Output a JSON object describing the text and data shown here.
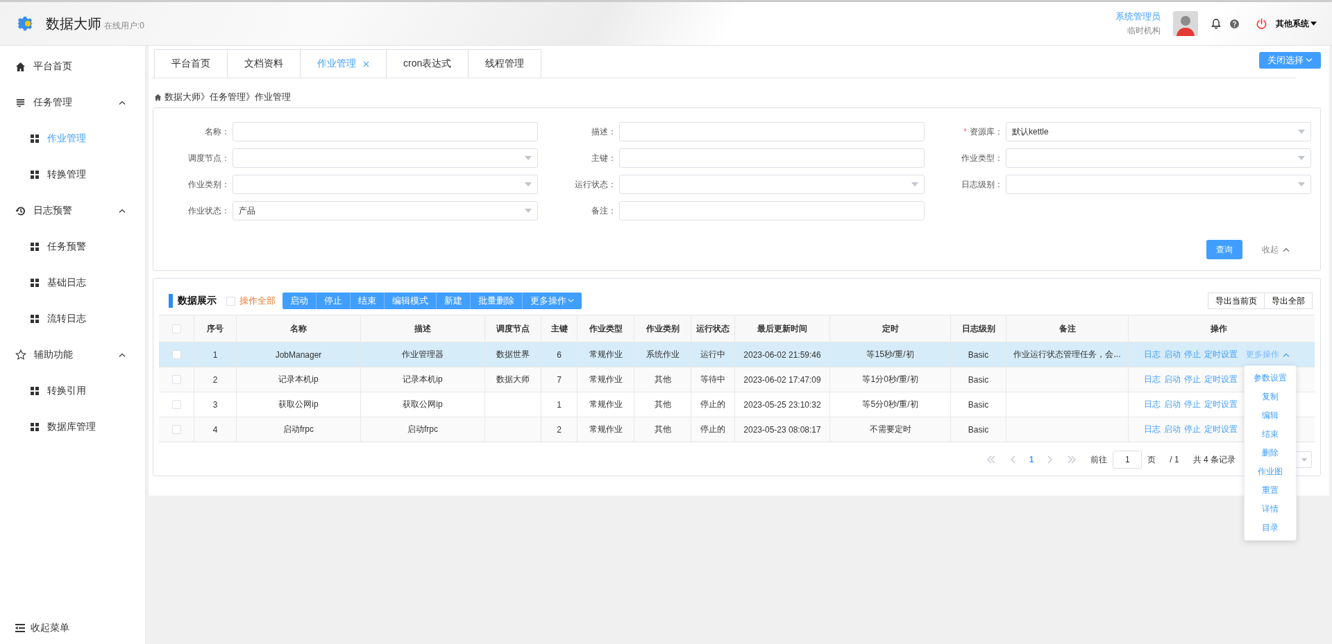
{
  "header": {
    "app_name": "数据大师",
    "online_users": "在线用户:0",
    "user_name": "系统管理员",
    "org": "临时机构",
    "system_menu": "其他系统"
  },
  "sidebar": {
    "items": [
      {
        "label": "平台首页",
        "kind": "link",
        "selected": false
      },
      {
        "label": "任务管理",
        "kind": "group",
        "expanded": true,
        "children": [
          {
            "label": "作业管理",
            "selected": true
          },
          {
            "label": "转换管理",
            "selected": false
          }
        ]
      },
      {
        "label": "日志预警",
        "kind": "group",
        "expanded": true,
        "children": [
          {
            "label": "任务预警",
            "selected": false
          },
          {
            "label": "基础日志",
            "selected": false
          },
          {
            "label": "流转日志",
            "selected": false
          }
        ]
      },
      {
        "label": "辅助功能",
        "kind": "group",
        "expanded": true,
        "children": [
          {
            "label": "转换引用",
            "selected": false
          },
          {
            "label": "数据库管理",
            "selected": false
          }
        ]
      }
    ],
    "collapse": "收起菜单"
  },
  "tabs": [
    {
      "label": "平台首页",
      "selected": false,
      "closable": false
    },
    {
      "label": "文档资料",
      "selected": false,
      "closable": false
    },
    {
      "label": "作业管理",
      "selected": true,
      "closable": true
    },
    {
      "label": "cron表达式",
      "selected": false,
      "closable": false
    },
    {
      "label": "线程管理",
      "selected": false,
      "closable": false
    }
  ],
  "close_tabs_button": "关闭选择",
  "breadcrumb": "数据大师》任务管理》作业管理",
  "filters": [
    {
      "label": "名称：",
      "kind": "input"
    },
    {
      "label": "描述：",
      "kind": "input"
    },
    {
      "required_mark": "*",
      "label": "资源库：",
      "kind": "select",
      "value": "默认kettle"
    },
    {
      "label": "调度节点：",
      "kind": "select"
    },
    {
      "label": "主键：",
      "kind": "input"
    },
    {
      "label": "作业类型：",
      "kind": "select"
    },
    {
      "label": "作业类别：",
      "kind": "select"
    },
    {
      "label": "运行状态：",
      "kind": "select"
    },
    {
      "label": "日志级别：",
      "kind": "select"
    },
    {
      "label": "作业状态：",
      "kind": "select",
      "value": "产品"
    },
    {
      "label": "备注：",
      "kind": "input"
    }
  ],
  "search_button": "查询",
  "collapse_filters": "收起",
  "table_title": "数据展示",
  "select_all": {
    "label": "操作全部",
    "checked": false
  },
  "toolbar": [
    "启动",
    "停止",
    "结束",
    "编辑模式",
    "新建",
    "批量删除",
    "更多操作"
  ],
  "export_buttons": [
    "导出当前页",
    "导出全部"
  ],
  "table": {
    "columns": [
      "序号",
      "名称",
      "描述",
      "调度节点",
      "主键",
      "作业类型",
      "作业类别",
      "运行状态",
      "最后更新时间",
      "定时",
      "日志级别",
      "备注",
      "操作"
    ],
    "header_checked": false,
    "rows": [
      {
        "selected": true,
        "checked": false,
        "cells": [
          "1",
          "JobManager",
          "作业管理器",
          "数据世界",
          "6",
          "常规作业",
          "系统作业",
          "运行中",
          "2023-06-02 21:59:46",
          "等15秒/重/初",
          "Basic",
          "作业运行状态管理任务，会..."
        ],
        "actions": [
          "日志",
          "启动",
          "停止",
          "定时设置"
        ],
        "more": {
          "label": "更多操作",
          "expanded": true
        }
      },
      {
        "selected": false,
        "checked": false,
        "cells": [
          "2",
          "记录本机ip",
          "记录本机ip",
          "数据大师",
          "7",
          "常规作业",
          "其他",
          "等待中",
          "2023-06-02 17:47:09",
          "等1分0秒/重/初",
          "Basic",
          ""
        ],
        "actions": [
          "日志",
          "启动",
          "停止",
          "定时设置"
        ]
      },
      {
        "selected": false,
        "checked": false,
        "cells": [
          "3",
          "获取公网ip",
          "获取公网ip",
          "",
          "1",
          "常规作业",
          "其他",
          "停止的",
          "2023-05-25 23:10:32",
          "等5分0秒/重/初",
          "Basic",
          ""
        ],
        "actions": [
          "日志",
          "启动",
          "停止",
          "定时设置"
        ]
      },
      {
        "selected": false,
        "checked": false,
        "cells": [
          "4",
          "启动frpc",
          "启动frpc",
          "",
          "2",
          "常规作业",
          "其他",
          "停止的",
          "2023-05-23 08:08:17",
          "不需要定时",
          "Basic",
          ""
        ],
        "actions": [
          "日志",
          "启动",
          "停止",
          "定时设置"
        ]
      }
    ]
  },
  "pagination": {
    "current_page": "1",
    "goto_label": "前往",
    "goto_value": "1",
    "page_unit": "页",
    "total_pages": "/ 1",
    "total": "共 4 条记录"
  },
  "more_menu": [
    "参数设置",
    "复制",
    "编辑",
    "结束",
    "删除",
    "作业图",
    "重置",
    "详情",
    "目录"
  ]
}
